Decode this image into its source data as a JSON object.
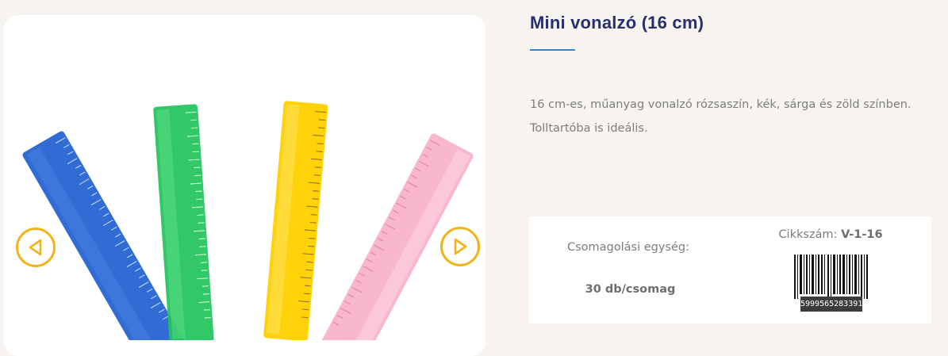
{
  "product": {
    "title": "Mini vonalzó (16 cm)",
    "description": [
      "16 cm-es, műanyag vonalzó rózsaszín, kék, sárga és zöld színben.",
      "Tolltartóba is ideális."
    ]
  },
  "gallery": {
    "image_icon": "rulers-photo",
    "prev_icon": "triangle-left-icon",
    "next_icon": "triangle-right-icon"
  },
  "info": {
    "pack_label": "Csomagolási egység:",
    "pack_value": "30 db/csomag",
    "sku_label": "Cikkszám:",
    "sku_value": "V-1-16",
    "barcode": "5999565283391"
  },
  "colors": {
    "title": "#27306b",
    "accent_rule": "#2a8ad6",
    "arrow": "#f2b41a",
    "ruler_blue": "#1f5fd0",
    "ruler_green": "#22c35a",
    "ruler_yellow": "#ffd20a",
    "ruler_pink": "#f8b6cf"
  }
}
